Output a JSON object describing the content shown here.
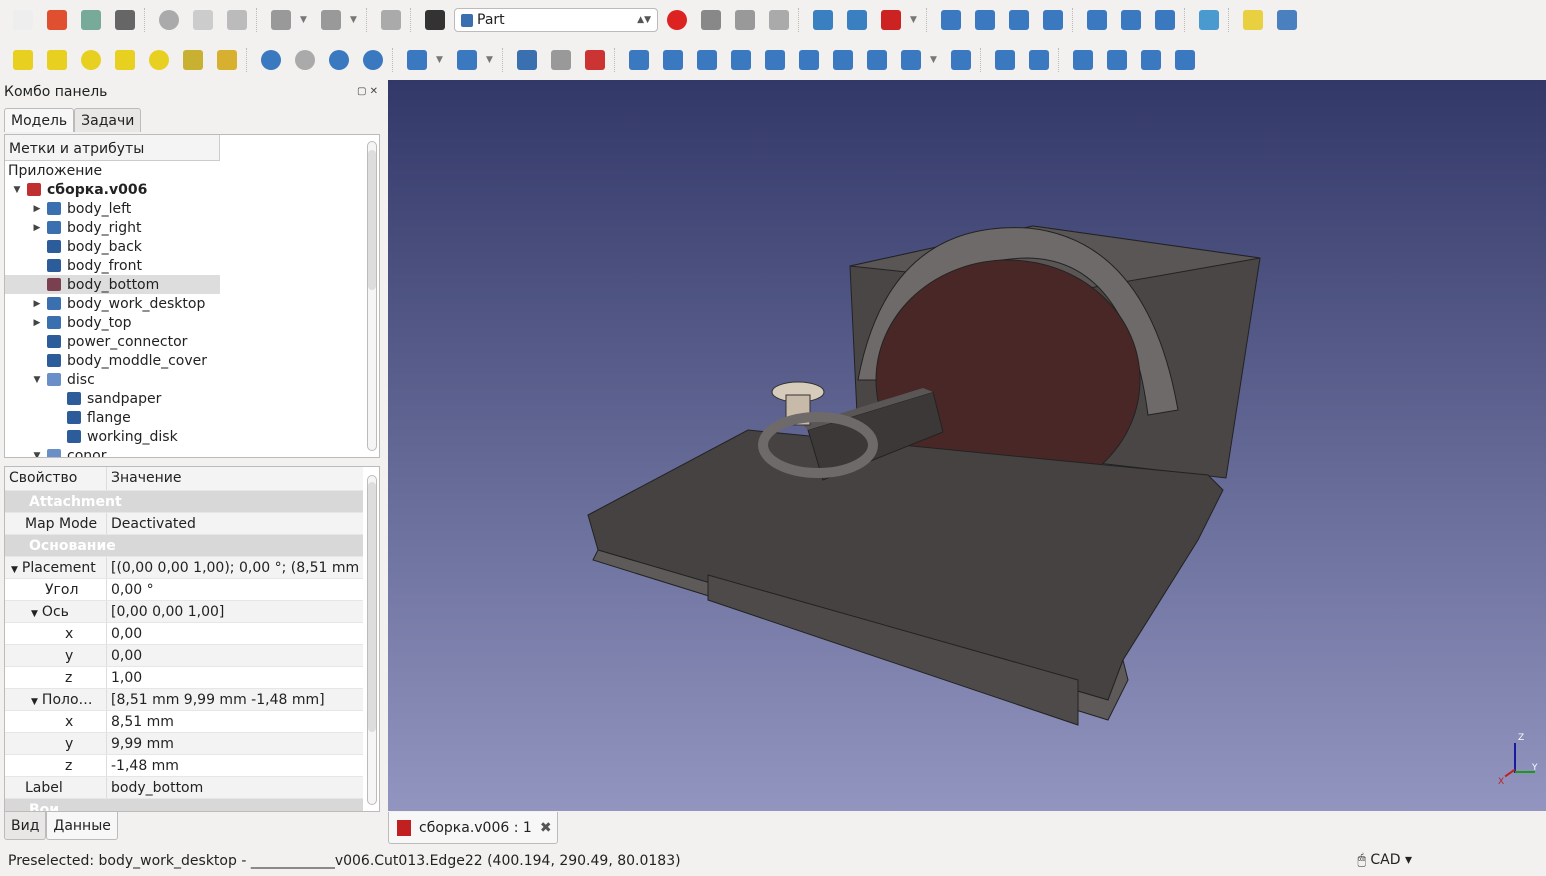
{
  "toolbar1": {
    "icons": [
      "new-file",
      "open-file",
      "save",
      "print",
      "sep",
      "cut",
      "copy",
      "paste",
      "sep",
      "undo",
      "undo-dropdown",
      "redo",
      "redo-dropdown",
      "sep",
      "refresh",
      "sep",
      "whats-this"
    ],
    "workbench": "Part",
    "icons2": [
      "record-macro",
      "stop-macro",
      "edit-macro",
      "run-macro",
      "sep",
      "fit-all",
      "fit-selection",
      "draw-style",
      "draw-style-dropdown",
      "sep",
      "isometric",
      "front",
      "top",
      "right",
      "sep",
      "rear",
      "bottom",
      "left",
      "sep",
      "measure",
      "sep",
      "part",
      "group"
    ]
  },
  "toolbar2": {
    "icons": [
      "box",
      "cylinder",
      "sphere",
      "cone",
      "torus",
      "tube",
      "primitives",
      "sep",
      "boolean",
      "cut",
      "union",
      "common",
      "sep",
      "join",
      "join-dropdown",
      "split",
      "split-dropdown",
      "sep",
      "check-geometry",
      "defeaturing",
      "cross-sections",
      "sep",
      "extrude",
      "revolve",
      "mirror",
      "fillet",
      "chamfer",
      "make-face",
      "ruled-surface",
      "loft",
      "sweep",
      "sweep-dropdown",
      "thickness",
      "sep",
      "attachment-editor",
      "shape-builder",
      "sep",
      "make-section",
      "projection",
      "compound",
      "shell"
    ]
  },
  "panel": {
    "title": "Комбо панель",
    "tabs": [
      "Модель",
      "Задачи"
    ],
    "tree_header": "Метки и атрибуты",
    "root": "Приложение",
    "items": [
      {
        "label": "сборка.v006",
        "level": 0,
        "tw": "▼",
        "bold": true,
        "color": "#c03030"
      },
      {
        "label": "body_left",
        "level": 1,
        "tw": "▶",
        "color": "#3a6fb0"
      },
      {
        "label": "body_right",
        "level": 1,
        "tw": "▶",
        "color": "#3a6fb0"
      },
      {
        "label": "body_back",
        "level": 1,
        "tw": "",
        "color": "#2d5c9a"
      },
      {
        "label": "body_front",
        "level": 1,
        "tw": "",
        "color": "#2d5c9a"
      },
      {
        "label": "body_bottom",
        "level": 1,
        "tw": "",
        "color": "#7a4050",
        "selected": true
      },
      {
        "label": "body_work_desktop",
        "level": 1,
        "tw": "▶",
        "color": "#3a6fb0"
      },
      {
        "label": "body_top",
        "level": 1,
        "tw": "▶",
        "color": "#3a6fb0"
      },
      {
        "label": "power_connector",
        "level": 1,
        "tw": "",
        "color": "#2d5c9a"
      },
      {
        "label": "body_moddle_cover",
        "level": 1,
        "tw": "",
        "color": "#2d5c9a"
      },
      {
        "label": "disc",
        "level": 1,
        "tw": "▼",
        "color": "#6a8ec8"
      },
      {
        "label": "sandpaper",
        "level": 2,
        "tw": "",
        "color": "#2d5c9a"
      },
      {
        "label": "flange",
        "level": 2,
        "tw": "",
        "color": "#2d5c9a"
      },
      {
        "label": "working_disk",
        "level": 2,
        "tw": "",
        "color": "#2d5c9a"
      },
      {
        "label": "conor",
        "level": 1,
        "tw": "▼",
        "color": "#6a8ec8"
      }
    ]
  },
  "properties": {
    "headers": [
      "Свойство",
      "Значение"
    ],
    "rows": [
      {
        "type": "group",
        "key": "Attachment"
      },
      {
        "key": "Map Mode",
        "value": "Deactivated",
        "indent": 1
      },
      {
        "type": "group",
        "key": "Основание"
      },
      {
        "key": "Placement",
        "value": "[(0,00 0,00 1,00); 0,00 °; (8,51 mm  …",
        "indent": 1,
        "tw": "▼"
      },
      {
        "key": "Угол",
        "value": "0,00 °",
        "indent": 2
      },
      {
        "key": "Ось",
        "value": "[0,00 0,00 1,00]",
        "indent": 2,
        "tw": "▼"
      },
      {
        "key": "x",
        "value": "0,00",
        "indent": 3
      },
      {
        "key": "y",
        "value": "0,00",
        "indent": 3
      },
      {
        "key": "z",
        "value": "1,00",
        "indent": 3
      },
      {
        "key": "Поло…",
        "value": "[8,51 mm  9,99 mm  -1,48 mm]",
        "indent": 2,
        "tw": "▼"
      },
      {
        "key": "x",
        "value": "8,51 mm",
        "indent": 3
      },
      {
        "key": "y",
        "value": "9,99 mm",
        "indent": 3
      },
      {
        "key": "z",
        "value": "-1,48 mm",
        "indent": 3
      },
      {
        "key": "Label",
        "value": "body_bottom",
        "indent": 1
      },
      {
        "type": "group",
        "key": "Вои"
      }
    ]
  },
  "bottom_tabs": [
    "Вид",
    "Данные"
  ],
  "document_tab": "сборка.v006 : 1",
  "status": "Preselected: body_work_desktop - ____________v006.Cut013.Edge22 (400.194, 290.49, 80.0183)",
  "navigation_style": "CAD",
  "axes": [
    "Z",
    "Y",
    "X"
  ]
}
